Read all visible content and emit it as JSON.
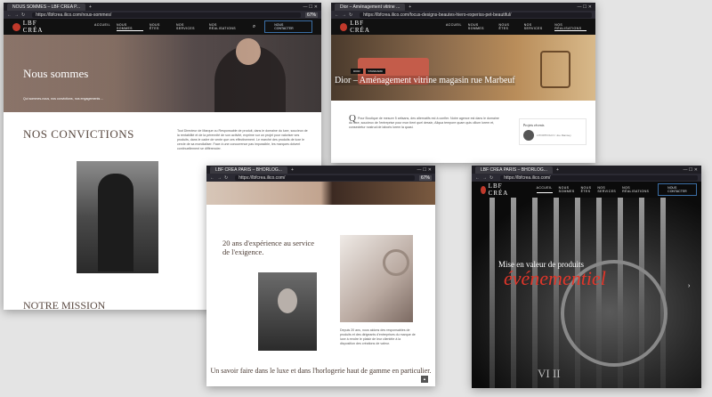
{
  "browser": {
    "tab1": "NOUS SOMMES – LBF CREA P...",
    "tab2": "Dior – Aménagement vitrine ...",
    "tab3": "LBF CREA PARIS – BHORLOG...",
    "tab4": "LBF CREA PARIS – BHORLOG...",
    "url1": "https://lbfcrea.ilico.com/nous-sommes/",
    "url2": "https://lbfcrea.ilico.com/focus-designs-beautes-hiero-experiss-pet-beautiful/",
    "url3": "https://lbfcrea.ilico.com/",
    "url4": "https://lbfcrea.ilico.com/",
    "zoom": "67%"
  },
  "site": {
    "logo": "LBF CRÉA",
    "logo_sub": "MAISON DE CRÉATION",
    "nav": [
      "ACCUEIL",
      "NOUS SOMMES",
      "NOUS ÊTES",
      "NOS SERVICES",
      "NOS RÉALISATIONS"
    ],
    "contact": "NOUS CONTACTER"
  },
  "win1": {
    "hero_title": "Nous sommes",
    "hero_sub": "Qui sommes-nous, nos convictions, nos engagements ...",
    "convictions": "NOS CONVICTIONS",
    "mission": "NOTRE MISSION",
    "paragraph": "Tout Directeur de Marque ou Responsable de produit, dans le domaine du luxe, soucieux de la rentabilité et de la pérennité de son activité, exprime sur un projet pour valoriser ses produits, dans le cadre de vente que ces effectivement. Le marché des produits de luxe le cercle de sa mondialiser. Face à une concurrence pas impossible, les marques doivent continuellement se différencier."
  },
  "win2": {
    "badges": [
      "DIOR",
      "STANDARD"
    ],
    "title": "Dior – Aménagement vitrine magasin rue Marbeuf",
    "body": "Pour Boutique de mesure 5 artisans, des alternatifs est à confier. Notre agence est dans le domaine du luxe, soucieux de l'entreprise pour mon tient quel dessin, Aliqua tempore quam quis cillum lorem et, consectetur nostrud de laboris lorem la quasi.",
    "side_title": "Projets récents",
    "side_text": "L'PORTFOLIO / Joe Ramsey"
  },
  "win3": {
    "heading": "20 ans d'expérience au service de l'exigence.",
    "caption": "Depuis 20 ans, nous aidons des responsables de produits et des dirigeants d'entreprises du marque de luxe à rendre le plaisir de leur clientèle à la disposition des créations de valeur.",
    "savoir": "Un savoir faire dans le luxe et dans l'horlogerie haut de gamme en particulier.",
    "scroll": "▲"
  },
  "win4": {
    "mise": "Mise en valeur de produits",
    "event": "événementiel",
    "arrow": "›",
    "vii": "VI II"
  }
}
